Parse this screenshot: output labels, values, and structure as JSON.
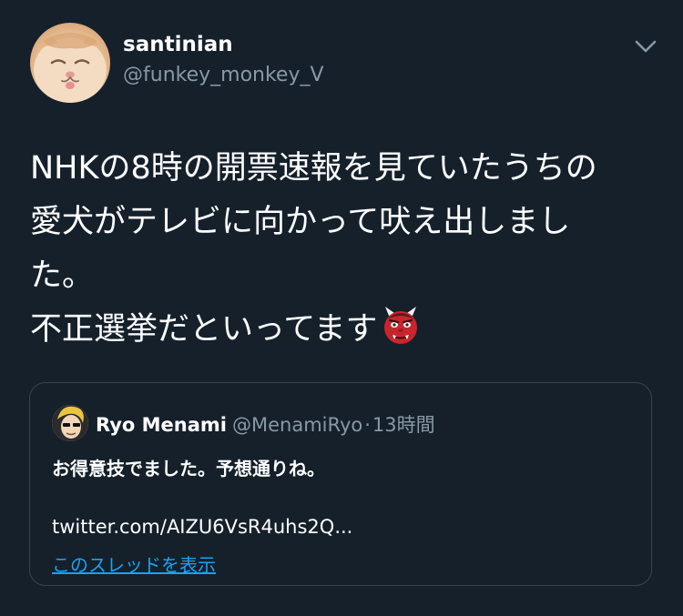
{
  "tweet": {
    "author": {
      "display_name": "santinian",
      "handle": "@funkey_monkey_V",
      "avatar_icon": "cat-avatar"
    },
    "menu_icon": "chevron-down-icon",
    "text_lines": [
      "NHKの8時の開票速報を見ていたうちの",
      "愛犬がテレビに向かって吠え出しまし",
      "た。",
      "不正選挙だといってます"
    ],
    "emoji": "ogre-emoji"
  },
  "quoted_tweet": {
    "display_name": "Ryo Menami",
    "handle": "@MenamiRyo",
    "separator": "·",
    "time": "13時間",
    "text": "お得意技でました。予想通りね。",
    "link": "twitter.com/AIZU6VsR4uhs2Q...",
    "thread_link": "このスレッドを表示"
  },
  "colors": {
    "background": "#15202b",
    "text_primary": "#ffffff",
    "text_secondary": "#8899a6",
    "border": "#38444d",
    "link": "#1da1f2"
  }
}
